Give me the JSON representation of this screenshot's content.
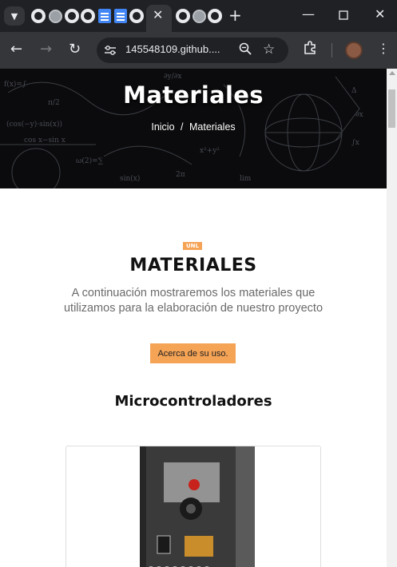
{
  "browser": {
    "url": "145548109.github....",
    "tabs": [
      {
        "icon": "github-icon"
      },
      {
        "icon": "globe-icon"
      },
      {
        "icon": "github-icon"
      },
      {
        "icon": "github-icon"
      },
      {
        "icon": "docs-icon"
      },
      {
        "icon": "docs-icon"
      },
      {
        "icon": "github-icon"
      },
      {
        "icon": "active-tab",
        "active": true
      },
      {
        "icon": "github-icon"
      },
      {
        "icon": "globe-icon"
      },
      {
        "icon": "github-icon"
      }
    ]
  },
  "hero": {
    "title": "Materiales",
    "breadcrumb": {
      "home": "Inicio",
      "separator": "/",
      "current": "Materiales"
    }
  },
  "section": {
    "badge": "UNL",
    "title": "MATERIALES",
    "intro": "A continuación mostraremos los materiales que utilizamos para la elaboración de nuestro proyecto",
    "cta_label": "Acerca de su uso.",
    "subtitle": "Microcontroladores"
  },
  "colors": {
    "accent": "#f5a355",
    "chrome_dark": "#202124",
    "chrome_toolbar": "#35363a",
    "hero_bg": "#0b0b0d"
  }
}
